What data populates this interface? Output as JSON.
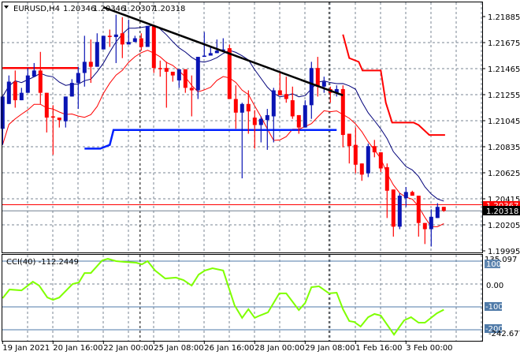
{
  "header": {
    "symbol": "EURUSD,H4",
    "open": "1.20346",
    "high": "1.20346",
    "low": "1.20307",
    "close": "1.20318"
  },
  "colors": {
    "bull": "#0a14b4",
    "bear": "#ff0000",
    "ma_upper": "#00007a",
    "ma_lower": "#ff0000",
    "cci": "#7fff00",
    "levels": "#4f7aa8",
    "grid": "#7a8593"
  },
  "price_axis": {
    "labels": [
      "1.21885",
      "1.21675",
      "1.21465",
      "1.21255",
      "1.21045",
      "1.20835",
      "1.20625",
      "1.20415",
      "1.20205",
      "1.19995"
    ],
    "ask_label": "1.20367",
    "bid_label": "1.20318"
  },
  "time_axis": {
    "labels": [
      "19 Jan 2021",
      "20 Jan 16:00",
      "22 Jan 00:00",
      "25 Jan 08:00",
      "26 Jan 16:00",
      "28 Jan 00:00",
      "29 Jan 08:00",
      "1 Feb 16:00",
      "3 Feb 00:00"
    ]
  },
  "cci_panel": {
    "title": "CCI(40) -112.2449",
    "max_label": "135.097",
    "min_label": "-242.6774",
    "level_100": "100",
    "level_0": "0.00",
    "level_m100": "-100",
    "level_m200": "-200"
  },
  "chart_data": {
    "type": "candlestick",
    "symbol": "EURUSD",
    "timeframe": "H4",
    "ylim": [
      1.19995,
      1.21885
    ],
    "ohlc": [
      [
        1.2098,
        1.2124,
        1.2085,
        1.2124
      ],
      [
        1.2118,
        1.2141,
        1.2118,
        1.2136
      ],
      [
        1.2136,
        1.2145,
        1.2115,
        1.2121
      ],
      [
        1.2121,
        1.2131,
        1.2121,
        1.2127
      ],
      [
        1.2127,
        1.2147,
        1.2127,
        1.2141
      ],
      [
        1.214,
        1.2151,
        1.214,
        1.2145
      ],
      [
        1.2145,
        1.216,
        1.2118,
        1.2127
      ],
      [
        1.2127,
        1.2127,
        1.2095,
        1.2107
      ],
      [
        1.2108,
        1.2117,
        1.2077,
        1.2107
      ],
      [
        1.2107,
        1.2107,
        1.2099,
        1.2105
      ],
      [
        1.2104,
        1.2124,
        1.2099,
        1.2124
      ],
      [
        1.2124,
        1.2138,
        1.2124,
        1.2135
      ],
      [
        1.2135,
        1.2148,
        1.2114,
        1.2143
      ],
      [
        1.2143,
        1.2173,
        1.2132,
        1.2152
      ],
      [
        1.2152,
        1.217,
        1.2135,
        1.2148
      ],
      [
        1.2148,
        1.2175,
        1.2148,
        1.2168
      ],
      [
        1.2162,
        1.2173,
        1.2162,
        1.2173
      ],
      [
        1.2173,
        1.2178,
        1.2164,
        1.2172
      ],
      [
        1.2172,
        1.219,
        1.2151,
        1.2174
      ],
      [
        1.2175,
        1.2188,
        1.2155,
        1.2166
      ],
      [
        1.2166,
        1.2186,
        1.2166,
        1.2168
      ],
      [
        1.2168,
        1.2173,
        1.2168,
        1.2171
      ],
      [
        1.2171,
        1.2175,
        1.2161,
        1.2164
      ],
      [
        1.2164,
        1.2181,
        1.2164,
        1.2181
      ],
      [
        1.2181,
        1.2182,
        1.2143,
        1.2147
      ],
      [
        1.2147,
        1.2153,
        1.214,
        1.2146
      ],
      [
        1.2147,
        1.2152,
        1.2115,
        1.2144
      ],
      [
        1.2144,
        1.2144,
        1.2136,
        1.2141
      ],
      [
        1.2137,
        1.2146,
        1.2131,
        1.2146
      ],
      [
        1.2146,
        1.2146,
        1.2127,
        1.2131
      ],
      [
        1.2131,
        1.2141,
        1.2108,
        1.2129
      ],
      [
        1.2129,
        1.2156,
        1.2122,
        1.2156
      ],
      [
        1.2156,
        1.2176,
        1.2156,
        1.2157
      ],
      [
        1.2157,
        1.2164,
        1.2157,
        1.2159
      ],
      [
        1.2159,
        1.217,
        1.2159,
        1.2161
      ],
      [
        1.2161,
        1.2171,
        1.2161,
        1.2162
      ],
      [
        1.2163,
        1.2166,
        1.2122,
        1.2122
      ],
      [
        1.2122,
        1.2133,
        1.2098,
        1.2111
      ],
      [
        1.2111,
        1.2119,
        1.2058,
        1.2118
      ],
      [
        1.2118,
        1.2129,
        1.2094,
        1.2112
      ],
      [
        1.2107,
        1.2113,
        1.2082,
        1.2101
      ],
      [
        1.2101,
        1.2108,
        1.2087,
        1.2106
      ],
      [
        1.2105,
        1.2114,
        1.2081,
        1.2109
      ],
      [
        1.2108,
        1.2131,
        1.2087,
        1.2129
      ],
      [
        1.2129,
        1.2143,
        1.2125,
        1.2125
      ],
      [
        1.2126,
        1.214,
        1.2119,
        1.2122
      ],
      [
        1.2121,
        1.2132,
        1.2106,
        1.2108
      ],
      [
        1.2109,
        1.2109,
        1.2094,
        1.2099
      ],
      [
        1.2099,
        1.2121,
        1.2099,
        1.2117
      ],
      [
        1.2117,
        1.2152,
        1.2106,
        1.2147
      ],
      [
        1.2147,
        1.2156,
        1.2124,
        1.2132
      ],
      [
        1.2132,
        1.214,
        1.2127,
        1.2136
      ],
      [
        1.213,
        1.2132,
        1.2119,
        1.2127
      ],
      [
        1.2127,
        1.2133,
        1.2124,
        1.213
      ],
      [
        1.213,
        1.2133,
        1.2083,
        1.2093
      ],
      [
        1.2094,
        1.2094,
        1.207,
        1.2084
      ],
      [
        1.2085,
        1.2099,
        1.2062,
        1.2069
      ],
      [
        1.207,
        1.207,
        1.2056,
        1.2061
      ],
      [
        1.2062,
        1.2086,
        1.2059,
        1.2084
      ],
      [
        1.2084,
        1.2089,
        1.2075,
        1.2079
      ],
      [
        1.2079,
        1.2079,
        1.2063,
        1.2066
      ],
      [
        1.2067,
        1.207,
        1.2026,
        1.2048
      ],
      [
        1.2049,
        1.2049,
        1.2011,
        1.2019
      ],
      [
        1.2019,
        1.2046,
        1.2017,
        1.2044
      ],
      [
        1.2042,
        1.2051,
        1.2035,
        1.2047
      ],
      [
        1.2047,
        1.2048,
        1.2044,
        1.2044
      ],
      [
        1.2044,
        1.2044,
        1.2011,
        1.2022
      ],
      [
        1.2022,
        1.2022,
        1.2005,
        1.2017
      ],
      [
        1.2017,
        1.2033,
        1.2003,
        1.2027
      ],
      [
        1.2026,
        1.2038,
        1.2026,
        1.2035
      ],
      [
        1.2035,
        1.2035,
        1.2031,
        1.20318
      ]
    ],
    "ma_period": 8,
    "ask": 1.20367,
    "bid": 1.20318,
    "trendline": [
      [
        16,
        1.2196
      ],
      [
        54,
        1.2125
      ]
    ],
    "resistance_line": [
      [
        0,
        1.2147
      ],
      [
        12,
        1.2147
      ]
    ],
    "support_steps": [
      [
        13,
        1.2082
      ],
      [
        15.5,
        1.2082
      ],
      [
        17,
        1.2085
      ],
      [
        17.6,
        1.2097
      ],
      [
        53,
        1.2097
      ]
    ],
    "upper_step_line": [
      [
        54,
        1.2174
      ],
      [
        55,
        1.2155
      ],
      [
        56.5,
        1.2152
      ],
      [
        57.1,
        1.2145
      ],
      [
        60,
        1.2145
      ],
      [
        60.8,
        1.2119
      ],
      [
        61.8,
        1.2103
      ],
      [
        65.2,
        1.2103
      ],
      [
        66,
        1.2101
      ],
      [
        67.7,
        1.2093
      ],
      [
        70.2,
        1.2093
      ]
    ],
    "period_separators": [
      22,
      52
    ],
    "time_label_bars": [
      0,
      8,
      16,
      24,
      32,
      40,
      48,
      56,
      64
    ],
    "cci": {
      "period": 40,
      "last": -112.2449,
      "range": [
        -242.6774,
        135.097
      ],
      "levels": [
        100,
        0,
        -100,
        -200
      ],
      "points": [
        [
          0,
          -62
        ],
        [
          1.1,
          -24
        ],
        [
          3,
          -28
        ],
        [
          4.8,
          10
        ],
        [
          5.8,
          -7
        ],
        [
          7.1,
          -59
        ],
        [
          8,
          -69
        ],
        [
          9,
          -59
        ],
        [
          11.1,
          0
        ],
        [
          12.1,
          7
        ],
        [
          13,
          48
        ],
        [
          14,
          48
        ],
        [
          15.8,
          103
        ],
        [
          16.7,
          110
        ],
        [
          18,
          100
        ],
        [
          19.2,
          97
        ],
        [
          21.2,
          93
        ],
        [
          22.1,
          86
        ],
        [
          23,
          100
        ],
        [
          24.2,
          59
        ],
        [
          25.8,
          24
        ],
        [
          27.5,
          28
        ],
        [
          28.7,
          17
        ],
        [
          30,
          -7
        ],
        [
          31.1,
          41
        ],
        [
          32.1,
          59
        ],
        [
          33.3,
          69
        ],
        [
          35,
          59
        ],
        [
          36.8,
          -93
        ],
        [
          38,
          -148
        ],
        [
          39,
          -110
        ],
        [
          40,
          -148
        ],
        [
          40.8,
          -138
        ],
        [
          42.1,
          -124
        ],
        [
          43.9,
          -41
        ],
        [
          45,
          -41
        ],
        [
          47,
          -114
        ],
        [
          48,
          -83
        ],
        [
          49,
          -14
        ],
        [
          50.2,
          -10
        ],
        [
          51.8,
          -41
        ],
        [
          53,
          -38
        ],
        [
          54,
          -110
        ],
        [
          55,
          -162
        ],
        [
          55.8,
          -166
        ],
        [
          56.8,
          -186
        ],
        [
          58,
          -145
        ],
        [
          59,
          -131
        ],
        [
          60,
          -138
        ],
        [
          62.1,
          -221
        ],
        [
          63.7,
          -159
        ],
        [
          64.8,
          -145
        ],
        [
          66,
          -169
        ],
        [
          67,
          -169
        ],
        [
          68.9,
          -128
        ],
        [
          70,
          -112.2449
        ]
      ]
    }
  }
}
